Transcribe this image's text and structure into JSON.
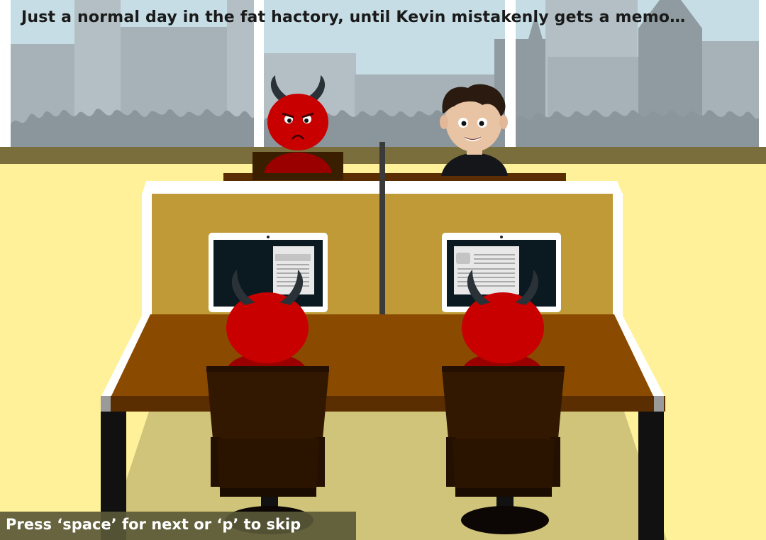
{
  "narration": {
    "caption": "Just a normal day in the fat hactory, until Kevin mistakenly gets a memo…"
  },
  "controls": {
    "hint": "Press ‘space’ for next or ‘p’ to skip"
  },
  "characters": [
    {
      "name": "boss-devil",
      "type": "devil",
      "expression": "grumpy"
    },
    {
      "name": "kevin",
      "type": "human",
      "expression": "smiling"
    },
    {
      "name": "worker-devil-left",
      "type": "devil",
      "expression": "back-view"
    },
    {
      "name": "worker-devil-right",
      "type": "devil",
      "expression": "back-view"
    }
  ],
  "colors": {
    "wall": "#fff19a",
    "sky": "#c6dde5",
    "buildings": "#a7b3b8",
    "devil_red": "#c80000",
    "horn": "#2a3238",
    "desk_top": "#8a4a00",
    "cubicle_panel": "#bf9a36",
    "chair": "#321800",
    "hint_bar": "#5a5837"
  }
}
